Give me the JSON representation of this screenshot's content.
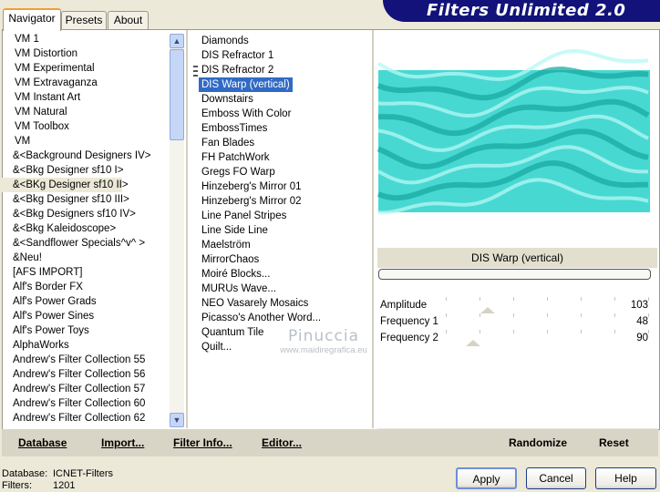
{
  "header": {
    "title": "Filters Unlimited 2.0"
  },
  "tabs": [
    {
      "label": "Navigator",
      "active": true
    },
    {
      "label": "Presets",
      "active": false
    },
    {
      "label": "About",
      "active": false
    }
  ],
  "categories": [
    "VM 1",
    "VM Distortion",
    "VM Experimental",
    "VM Extravaganza",
    "VM Instant Art",
    "VM Natural",
    "VM Toolbox",
    "VM",
    "&<Background Designers IV>",
    "&<Bkg Designer sf10 I>",
    "&<BKg Designer sf10 II>",
    "&<Bkg Designer sf10 III>",
    "&<Bkg Designers sf10 IV>",
    "&<Bkg Kaleidoscope>",
    "&<Sandflower Specials^v^ >",
    "&Neu!",
    "[AFS IMPORT]",
    "Alf's Border FX",
    "Alf's Power Grads",
    "Alf's Power Sines",
    "Alf's Power Toys",
    "AlphaWorks",
    "Andrew's Filter Collection 55",
    "Andrew's Filter Collection 56",
    "Andrew's Filter Collection 57",
    "Andrew's Filter Collection 60",
    "Andrew's Filter Collection 62"
  ],
  "selected_category": "&<BKg Designer sf10 II>",
  "filters": [
    "Diamonds",
    "DIS Refractor 1",
    "DIS Refractor 2",
    "DIS Warp (vertical)",
    "Downstairs",
    "Emboss With Color",
    "EmbossTimes",
    "Fan Blades",
    "FH PatchWork",
    "Gregs FO Warp",
    "Hinzeberg's Mirror 01",
    "Hinzeberg's Mirror 02",
    "Line Panel Stripes",
    "Line Side Line",
    "Maelström",
    "MirrorChaos",
    "Moiré Blocks...",
    "MURUs Wave...",
    "NEO Vasarely Mosaics",
    "Picasso's Another Word...",
    "Quantum Tile",
    "Quilt..."
  ],
  "selected_filter": "DIS Warp (vertical)",
  "preview": {
    "filter_name": "DIS Warp (vertical)",
    "progress": 0
  },
  "params": [
    {
      "label": "Amplitude",
      "value": "103",
      "level": 0.404
    },
    {
      "label": "Frequency 1",
      "value": "48",
      "level": 0.188
    },
    {
      "label": "Frequency 2",
      "value": "90",
      "level": 0.353
    }
  ],
  "watermark": {
    "line1": "Pinuccia",
    "line2": "www.maidiregrafica.eu"
  },
  "toolbar": {
    "database": "Database",
    "import": "Import...",
    "filter_info": "Filter Info...",
    "editor": "Editor...",
    "randomize": "Randomize",
    "reset": "Reset"
  },
  "footer": {
    "database_label": "Database:",
    "database_value": "ICNET-Filters",
    "filters_label": "Filters:",
    "filters_value": "1201"
  },
  "buttons": {
    "apply": "Apply",
    "cancel": "Cancel",
    "help": "Help"
  },
  "colors": {
    "selection": "#316ac5",
    "banner": "#12127a",
    "preview_cyan": "#3fd6d0"
  }
}
